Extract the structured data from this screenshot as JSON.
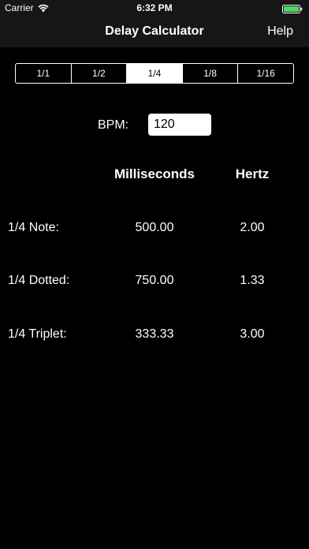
{
  "status_bar": {
    "carrier": "Carrier",
    "time": "6:32 PM"
  },
  "nav": {
    "title": "Delay Calculator",
    "help_label": "Help"
  },
  "note_segments": {
    "options": [
      "1/1",
      "1/2",
      "1/4",
      "1/8",
      "1/16"
    ],
    "selected": "1/4"
  },
  "bpm": {
    "label": "BPM:",
    "value": "120"
  },
  "results": {
    "headers": {
      "milliseconds": "Milliseconds",
      "hertz": "Hertz"
    },
    "rows": [
      {
        "label": "1/4 Note:",
        "ms": "500.00",
        "hz": "2.00"
      },
      {
        "label": "1/4 Dotted:",
        "ms": "750.00",
        "hz": "1.33"
      },
      {
        "label": "1/4 Triplet:",
        "ms": "333.33",
        "hz": "3.00"
      }
    ]
  },
  "colors": {
    "background": "#000000",
    "bar_background": "#161616",
    "text": "#ffffff",
    "battery": "#4cd964"
  }
}
